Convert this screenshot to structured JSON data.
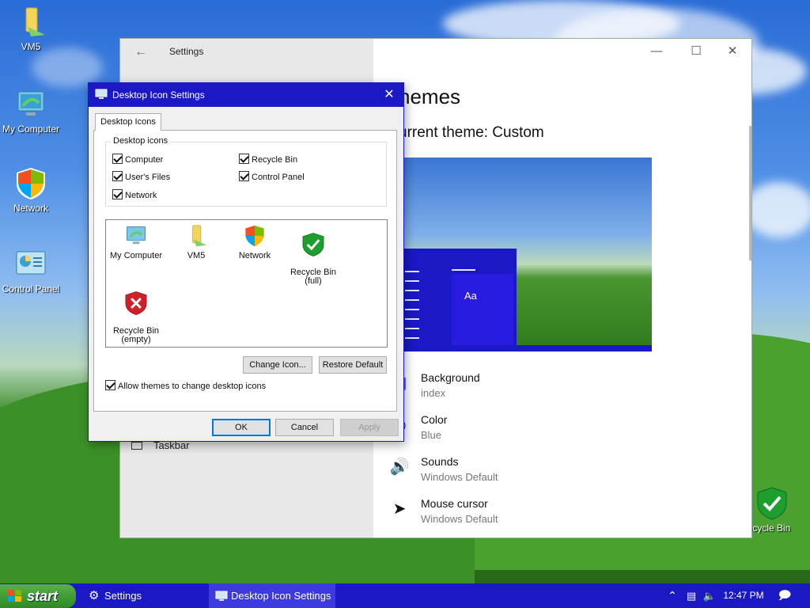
{
  "desktop": {
    "icons": [
      {
        "label": "VM5",
        "icon": "folder-icon"
      },
      {
        "label": "My Computer",
        "icon": "my-computer-icon"
      },
      {
        "label": "Network",
        "icon": "network-icon"
      },
      {
        "label": "Control Panel",
        "icon": "control-panel-icon"
      },
      {
        "label": "Recycle Bin",
        "icon": "recycle-bin-full-icon"
      }
    ]
  },
  "settings": {
    "title": "Settings",
    "heading": "hemes",
    "current_theme": "urrent theme: Custom",
    "preview_text": "Aa",
    "rows": [
      {
        "label": "Background",
        "value": "index"
      },
      {
        "label": "Color",
        "value": "Blue"
      },
      {
        "label": "Sounds",
        "value": "Windows Default"
      },
      {
        "label": "Mouse cursor",
        "value": "Windows Default"
      }
    ],
    "left_item": "Taskbar",
    "accent": "#1b18c6"
  },
  "dialog": {
    "title": "Desktop Icon Settings",
    "tab": "Desktop Icons",
    "group_label": "Desktop icons",
    "checkboxes": [
      {
        "label": "Computer",
        "checked": true
      },
      {
        "label": "Recycle Bin",
        "checked": true
      },
      {
        "label": "User's Files",
        "checked": true
      },
      {
        "label": "Control Panel",
        "checked": true
      },
      {
        "label": "Network",
        "checked": true
      }
    ],
    "icon_list": [
      {
        "label": "My Computer"
      },
      {
        "label": "VM5"
      },
      {
        "label": "Network"
      },
      {
        "label": "Recycle Bin\n(full)"
      },
      {
        "label": "Recycle Bin\n(empty)"
      }
    ],
    "change_icon": "Change Icon...",
    "restore_default": "Restore Default",
    "allow_themes": "Allow themes to change desktop icons",
    "ok": "OK",
    "cancel": "Cancel",
    "apply": "Apply"
  },
  "taskbar": {
    "start": "start",
    "items": [
      {
        "label": "Settings",
        "active": false
      },
      {
        "label": "Desktop Icon Settings",
        "active": true
      }
    ],
    "clock": "12:47 PM"
  }
}
